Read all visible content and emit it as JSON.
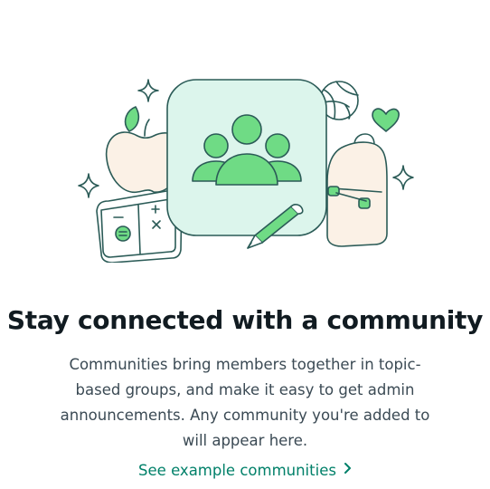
{
  "empty_state": {
    "title": "Stay connected with a community",
    "description": "Communities bring members together in topic-based groups, and make it easy to get admin announcements. Any community you're added to will appear here.",
    "link_label": "See example communities"
  },
  "illustration": {
    "icons": [
      "sparkle-icon",
      "apple-icon",
      "volleyball-icon",
      "heart-icon",
      "backpack-icon",
      "notebook-icon",
      "pencil-icon",
      "community-group-icon"
    ]
  },
  "colors": {
    "accent_green": "#6fdb85",
    "tile_bg": "#dcf5ec",
    "outline": "#2b5b57",
    "link": "#008069",
    "title": "#111b21",
    "body_text": "#3b4a54"
  }
}
